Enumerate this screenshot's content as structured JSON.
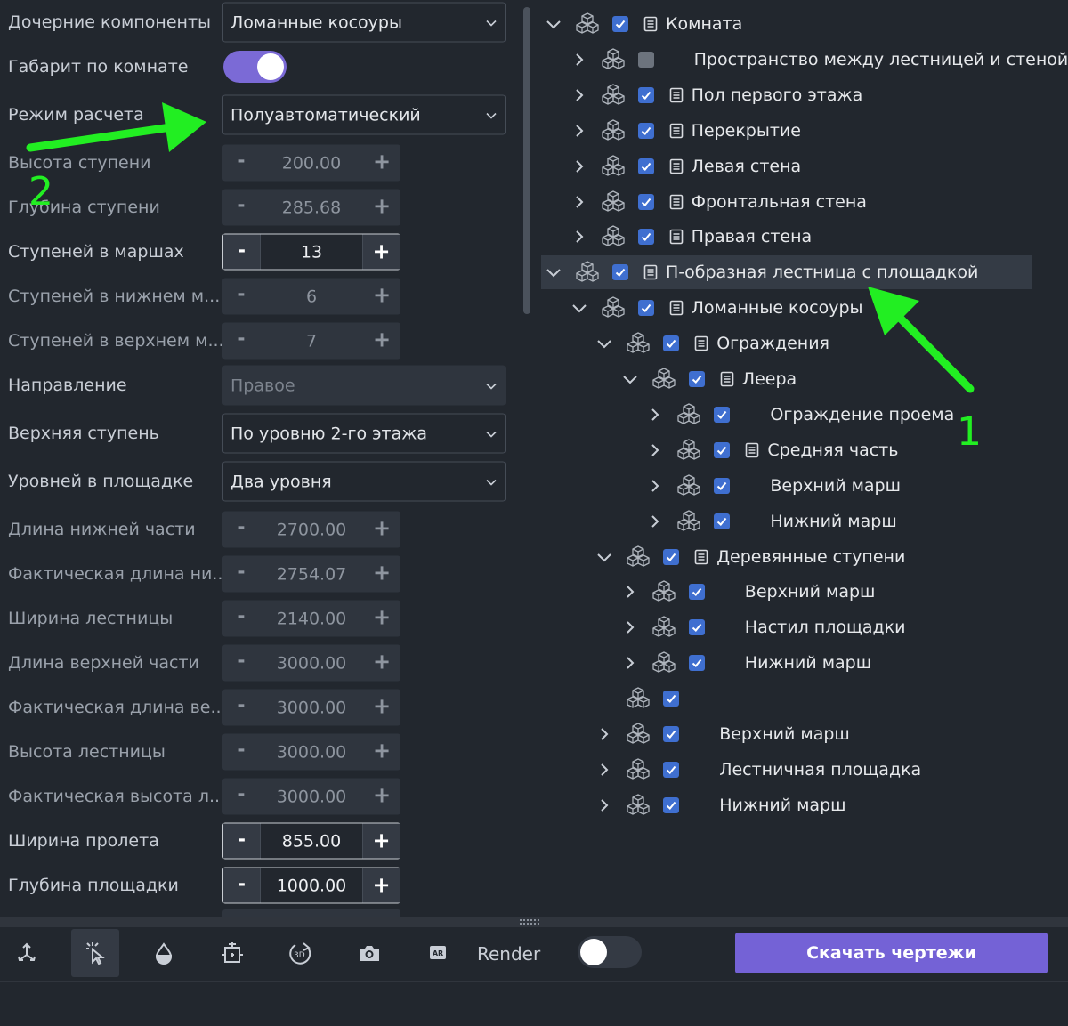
{
  "properties": [
    {
      "label": "Дочерние компоненты",
      "type": "select",
      "value": "Ломанные косоуры"
    },
    {
      "label": "Габарит по комнате",
      "type": "toggle",
      "on": true
    },
    {
      "label": "Режим расчета",
      "type": "select",
      "value": "Полуавтоматический"
    },
    {
      "label": "Высота ступени",
      "type": "stepper",
      "value": "200.00",
      "active": false
    },
    {
      "label": "Глубина ступени",
      "type": "stepper",
      "value": "285.68",
      "active": false
    },
    {
      "label": "Ступеней в маршах",
      "type": "stepper",
      "value": "13",
      "active": true
    },
    {
      "label": "Ступеней в нижнем м...",
      "type": "stepper",
      "value": "6",
      "active": false
    },
    {
      "label": "Ступеней в верхнем м...",
      "type": "stepper",
      "value": "7",
      "active": false
    },
    {
      "label": "Направление",
      "type": "select",
      "value": "Правое",
      "disabled": true
    },
    {
      "label": "Верхняя ступень",
      "type": "select",
      "value": "По уровню 2-го этажа"
    },
    {
      "label": "Уровней в площадке",
      "type": "select",
      "value": "Два уровня"
    },
    {
      "label": "Длина нижней части",
      "type": "stepper",
      "value": "2700.00",
      "active": false
    },
    {
      "label": "Фактическая длина ни...",
      "type": "stepper",
      "value": "2754.07",
      "active": false
    },
    {
      "label": "Ширина лестницы",
      "type": "stepper",
      "value": "2140.00",
      "active": false
    },
    {
      "label": "Длина верхней части",
      "type": "stepper",
      "value": "3000.00",
      "active": false
    },
    {
      "label": "Фактическая длина ве...",
      "type": "stepper",
      "value": "3000.00",
      "active": false
    },
    {
      "label": "Высота лестницы",
      "type": "stepper",
      "value": "3000.00",
      "active": false
    },
    {
      "label": "Фактическая высота л...",
      "type": "stepper",
      "value": "3000.00",
      "active": false
    },
    {
      "label": "Ширина пролета",
      "type": "stepper",
      "value": "855.00",
      "active": true
    },
    {
      "label": "Глубина площадки",
      "type": "stepper",
      "value": "1000.00",
      "active": true
    }
  ],
  "stepper_labels": {
    "minus": "-",
    "plus": "+"
  },
  "tree": [
    {
      "label": "Комната",
      "depth": 0,
      "expanded": true,
      "has_doc": true,
      "checked": true
    },
    {
      "label": "Пространство между лестницей и стеной",
      "depth": 1,
      "expanded": false,
      "has_doc": false,
      "checked": false
    },
    {
      "label": "Пол первого этажа",
      "depth": 1,
      "expanded": false,
      "has_doc": true,
      "checked": true
    },
    {
      "label": "Перекрытие",
      "depth": 1,
      "expanded": false,
      "has_doc": true,
      "checked": true
    },
    {
      "label": "Левая стена",
      "depth": 1,
      "expanded": false,
      "has_doc": true,
      "checked": true
    },
    {
      "label": "Фронтальная стена",
      "depth": 1,
      "expanded": false,
      "has_doc": true,
      "checked": true
    },
    {
      "label": "Правая стена",
      "depth": 1,
      "expanded": false,
      "has_doc": true,
      "checked": true
    },
    {
      "label": "П-образная лестница с площадкой",
      "depth": 0,
      "expanded": true,
      "has_doc": true,
      "checked": true,
      "selected": true
    },
    {
      "label": "Ломанные косоуры",
      "depth": 1,
      "expanded": true,
      "has_doc": true,
      "checked": true
    },
    {
      "label": "Ограждения",
      "depth": 2,
      "expanded": true,
      "has_doc": true,
      "checked": true
    },
    {
      "label": "Леера",
      "depth": 3,
      "expanded": true,
      "has_doc": true,
      "checked": true
    },
    {
      "label": "Ограждение проема",
      "depth": 4,
      "expanded": false,
      "has_doc": false,
      "checked": true
    },
    {
      "label": "Средняя часть",
      "depth": 4,
      "expanded": false,
      "has_doc": true,
      "checked": true
    },
    {
      "label": "Верхний марш",
      "depth": 4,
      "expanded": false,
      "has_doc": false,
      "checked": true
    },
    {
      "label": "Нижний марш",
      "depth": 4,
      "expanded": false,
      "has_doc": false,
      "checked": true
    },
    {
      "label": "Деревянные ступени",
      "depth": 2,
      "expanded": true,
      "has_doc": true,
      "checked": true
    },
    {
      "label": "Верхний марш",
      "depth": 3,
      "expanded": false,
      "has_doc": false,
      "checked": true
    },
    {
      "label": "Настил площадки",
      "depth": 3,
      "expanded": false,
      "has_doc": false,
      "checked": true
    },
    {
      "label": "Нижний марш",
      "depth": 3,
      "expanded": false,
      "has_doc": false,
      "checked": true
    },
    {
      "label": "",
      "depth": 2,
      "no_caret": true,
      "has_doc": false,
      "checked": true
    },
    {
      "label": "Верхний марш",
      "depth": 2,
      "expanded": false,
      "has_doc": false,
      "checked": true
    },
    {
      "label": "Лестничная площадка",
      "depth": 2,
      "expanded": false,
      "has_doc": false,
      "checked": true
    },
    {
      "label": "Нижний марш",
      "depth": 2,
      "expanded": false,
      "has_doc": false,
      "checked": true
    }
  ],
  "toolbar": {
    "tools": [
      {
        "icon": "transform-icon",
        "active": false
      },
      {
        "icon": "select-cursor-icon",
        "active": true
      },
      {
        "icon": "material-drop-icon",
        "active": false
      },
      {
        "icon": "dimension-frame-icon",
        "active": false
      },
      {
        "icon": "rotate-3d-icon",
        "active": false
      },
      {
        "icon": "camera-icon",
        "active": false
      },
      {
        "icon": "ar-icon",
        "active": false
      }
    ],
    "ar_text": "AR",
    "label_3d": "3D",
    "render_label": "Render",
    "render_on": false,
    "download_label": "Скачать чертежи"
  },
  "annotations": {
    "arrow1_label": "1",
    "arrow2_label": "2",
    "color": "#22ee22"
  },
  "colors": {
    "accent": "#7462d6",
    "toggle_on": "#7b6ad6",
    "checkbox": "#3f6fd0",
    "background": "#22272e"
  }
}
